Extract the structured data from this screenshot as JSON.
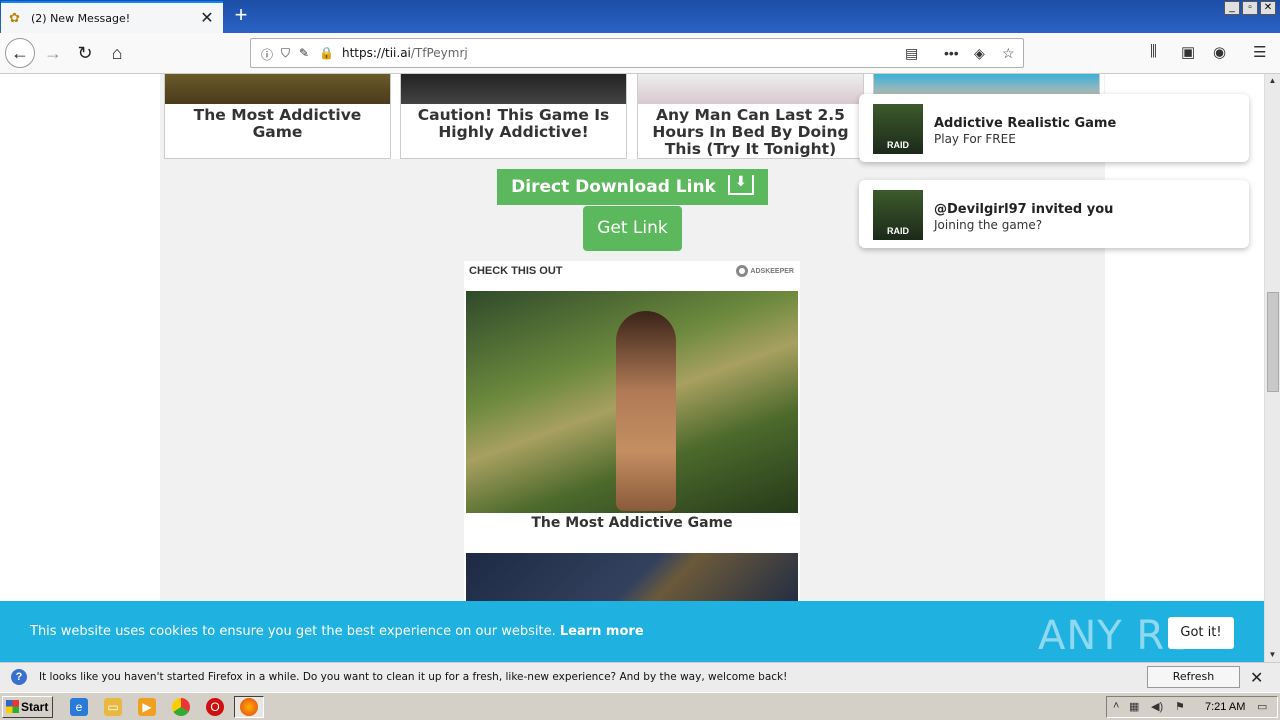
{
  "browser": {
    "tab_title": "(2) New Message!",
    "tab_close": "✕",
    "new_tab": "+",
    "url_host": "https://tii.ai",
    "url_path": "/TfPeymrj",
    "window_buttons": [
      "_",
      "▫",
      "✕"
    ]
  },
  "cards": [
    {
      "caption": "The Most Addictive Game"
    },
    {
      "caption": "Caution! This Game Is Highly Addictive!"
    },
    {
      "caption": "Any Man Can Last 2.5 Hours In Bed By Doing This (Try It Tonight)"
    },
    {
      "caption": ""
    }
  ],
  "buttons": {
    "direct_download": "Direct Download Link",
    "get_link": "Get Link"
  },
  "widget": {
    "header": "CHECK THIS OUT",
    "brand": "ADSKEEPER",
    "caption": "The Most Addictive Game"
  },
  "notifications": [
    {
      "title": "Addictive Realistic Game",
      "body": "Play For FREE",
      "avatar_label": "RAID"
    },
    {
      "title": "@Devilgirl97 invited you",
      "body": "Joining the game?",
      "avatar_label": "RAID"
    }
  ],
  "cookie": {
    "message": "This website uses cookies to ensure you get the best experience on our website. ",
    "learn_more": "Learn more",
    "got_it": "Got it!",
    "watermark": "ANY RUN"
  },
  "firefox_bar": {
    "message": "It looks like you haven't started Firefox in a while. Do you want to clean it up for a fresh, like-new experience? And by the way, welcome back!",
    "refresh_button": "Refresh Firefox…"
  },
  "taskbar": {
    "start_label": "Start",
    "time": "7:21 AM"
  }
}
